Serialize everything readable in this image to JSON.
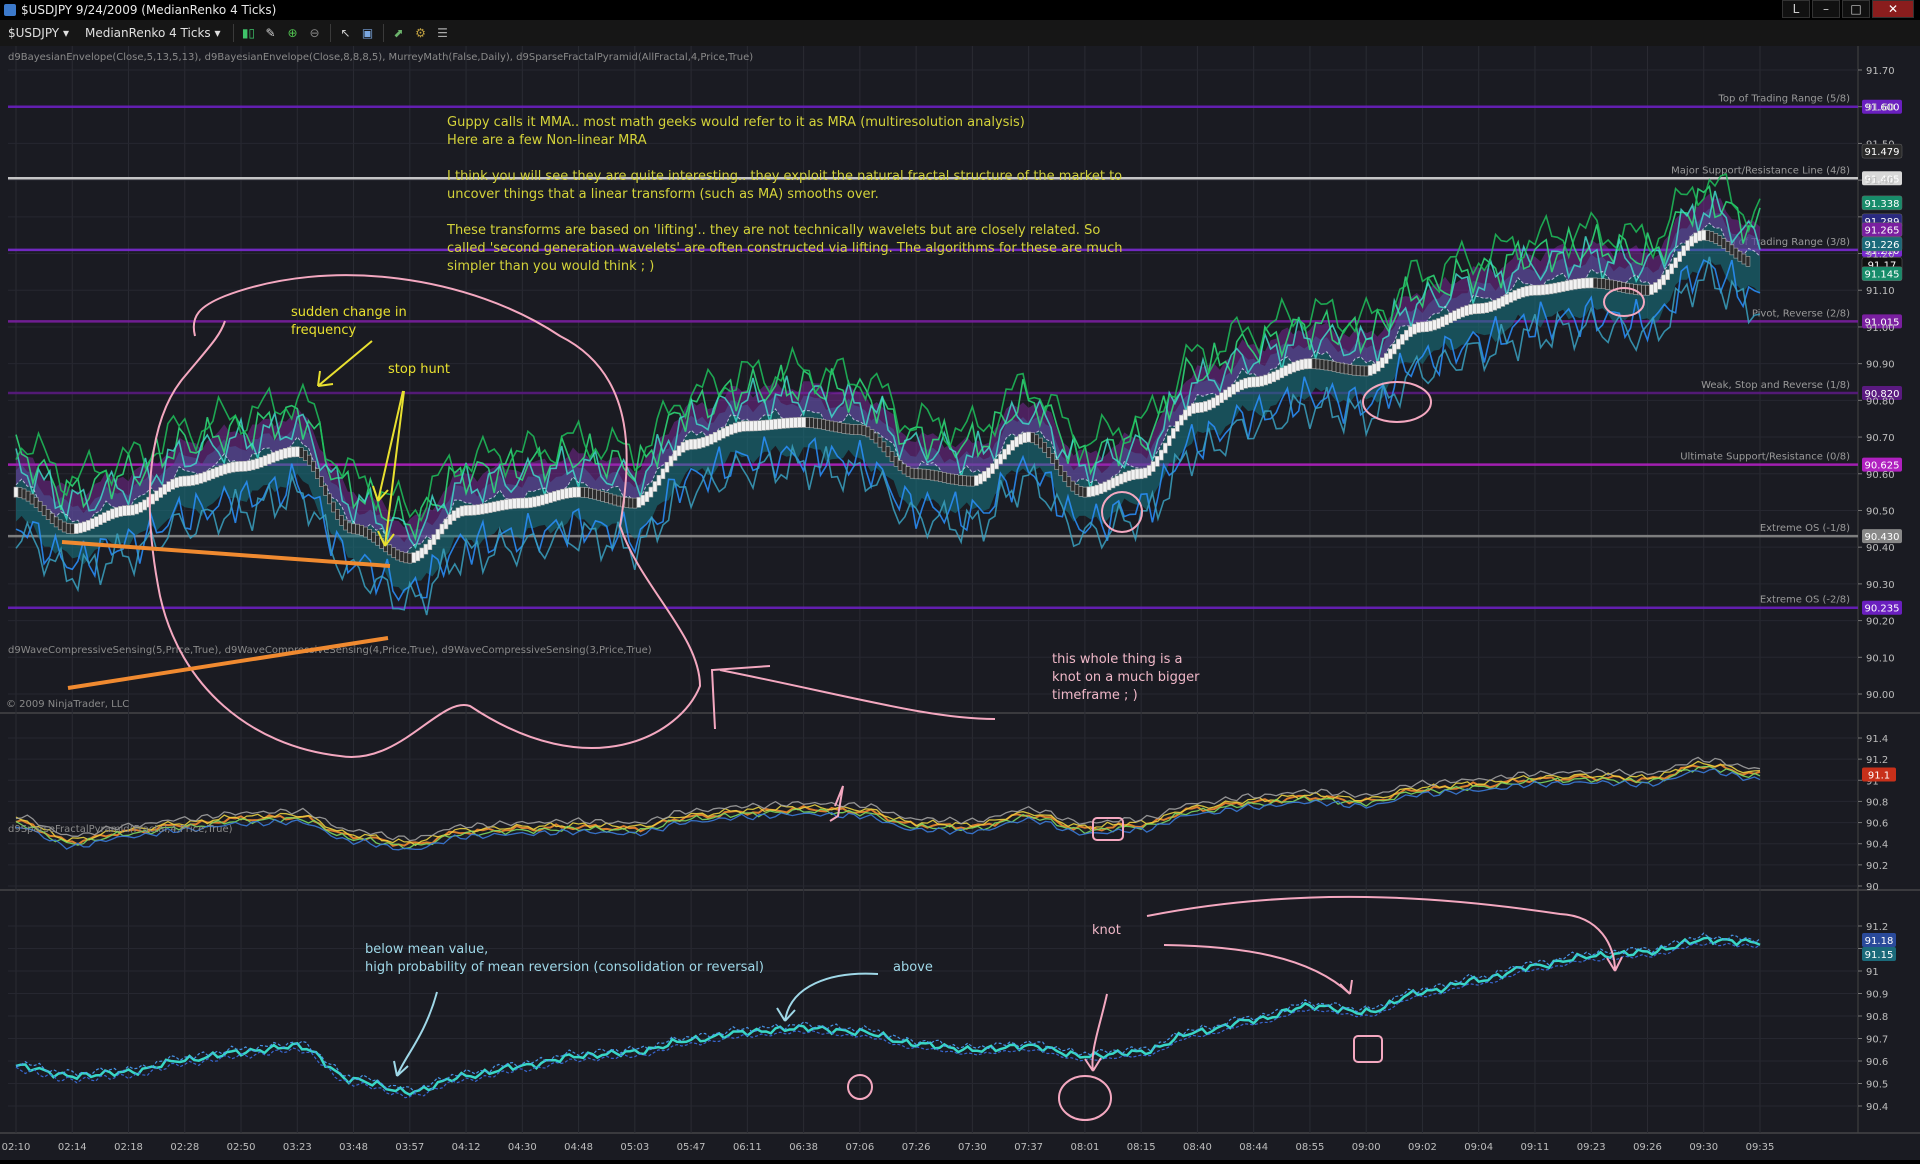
{
  "window": {
    "title": "$USDJPY  9/24/2009 (MedianRenko 4 Ticks)",
    "controls": [
      "L",
      "–",
      "□",
      "✕"
    ]
  },
  "toolbar": {
    "instrument": "$USDJPY",
    "period": "MedianRenko 4 Ticks"
  },
  "panels": [
    {
      "indicator_label": "d9BayesianEnvelope(Close,5,13,5,13), d9BayesianEnvelope(Close,8,8,8,5), MurreyMath(False,Daily), d9SparseFractalPyramid(AllFractal,4,Price,True)",
      "y_ticks": [
        "91.70",
        "91.60",
        "91.50",
        "91.40",
        "91.30",
        "91.20",
        "91.10",
        "91.00",
        "90.90",
        "90.80",
        "90.70",
        "90.60",
        "90.50",
        "90.40",
        "90.30",
        "90.20",
        "90.10",
        "90.00"
      ]
    },
    {
      "indicator_label": "d9WaveCompressiveSensing(5,Price,True), d9WaveCompressiveSensing(4,Price,True), d9WaveCompressiveSensing(3,Price,True)",
      "y_ticks": [
        "91.4",
        "91.2",
        "91",
        "90.8",
        "90.6",
        "90.4",
        "90.2",
        "90"
      ]
    },
    {
      "indicator_label": "d9SparseFractalPyramid(Fractal,4,Price,True)",
      "y_ticks": [
        "91.2",
        "91.1",
        "91",
        "90.9",
        "90.8",
        "90.7",
        "90.6",
        "90.5",
        "90.4"
      ]
    }
  ],
  "x_ticks": [
    "02:10",
    "02:14",
    "02:18",
    "02:28",
    "02:50",
    "03:23",
    "03:48",
    "03:57",
    "04:12",
    "04:30",
    "04:48",
    "05:03",
    "05:47",
    "06:11",
    "06:38",
    "07:06",
    "07:26",
    "07:30",
    "07:37",
    "08:01",
    "08:15",
    "08:40",
    "08:44",
    "08:55",
    "09:00",
    "09:02",
    "09:04",
    "09:11",
    "09:23",
    "09:26",
    "09:30",
    "09:35"
  ],
  "murrey_lines": [
    {
      "label": "Top of Trading Range (5/8)",
      "value": "91.600",
      "color": "#6a1fbf"
    },
    {
      "label": "Major Support/Resistance Line (4/8)",
      "value": "91.405",
      "color": "#d8d8d8"
    },
    {
      "label": "Top of Trading Range (3/8)",
      "value": "91.210",
      "color": "#7a2ad0"
    },
    {
      "label": "Pivot, Reverse (2/8)",
      "value": "91.015",
      "color": "#7a1fa0"
    },
    {
      "label": "Weak, Stop and Reverse (1/8)",
      "value": "90.820",
      "color": "#5a1a80"
    },
    {
      "label": "Ultimate Support/Resistance (0/8)",
      "value": "90.625",
      "color": "#b020c0"
    },
    {
      "label": "Extreme OS (-1/8)",
      "value": "90.430",
      "color": "#888888"
    },
    {
      "label": "Extreme OS (-2/8)",
      "value": "90.235",
      "color": "#6a1fbf"
    }
  ],
  "price_badges": [
    {
      "value": "91.479",
      "color": "#2a2a2a"
    },
    {
      "value": "91.338",
      "color": "#178c6a"
    },
    {
      "value": "91.289",
      "color": "#2a2a80"
    },
    {
      "value": "91.265",
      "color": "#7a1fa0"
    },
    {
      "value": "91.226",
      "color": "#1b6a7a"
    },
    {
      "value": "91.17",
      "color": "#101010"
    },
    {
      "value": "91.145",
      "color": "#178c6a"
    }
  ],
  "lower_badges": [
    {
      "value": "91.1",
      "color": "#c8301a"
    },
    {
      "value": "91.18",
      "color": "#2a4a9a"
    },
    {
      "value": "91.15",
      "color": "#1b6a7a"
    }
  ],
  "copyright": "© 2009 NinjaTrader, LLC",
  "annotations": {
    "main_text": [
      "Guppy calls it MMA.. most math geeks would refer to it as MRA (multiresolution analysis)",
      "Here are a few Non-linear MRA",
      "",
      "I think you will see they are quite interesting.. they exploit the natural fractal structure of the market to",
      "uncover things that a linear transform (such as MA) smooths over.",
      "",
      "These transforms are based on 'lifting'.. they are not technically wavelets but are closely related.  So",
      "called 'second generation wavelets' are often constructed via lifting.  The algorithms for these are much",
      "simpler than you would think ; )"
    ],
    "sudden_change": [
      "sudden change in",
      "frequency"
    ],
    "stop_hunt": "stop hunt",
    "knot_text": [
      "this whole thing is a",
      "knot on a much bigger",
      "timeframe ; )"
    ],
    "below_mean": [
      "below mean value,",
      "high probability of mean reversion (consolidation or reversal)"
    ],
    "above": "above",
    "knot": "knot"
  },
  "chart_data": [
    {
      "type": "line",
      "title": "",
      "ylim": [
        90.0,
        91.7
      ],
      "x": [
        "02:10",
        "02:14",
        "02:18",
        "02:28",
        "02:50",
        "03:23",
        "03:48",
        "03:57",
        "04:12",
        "04:30",
        "04:48",
        "05:03",
        "05:47",
        "06:11",
        "06:38",
        "07:06",
        "07:26",
        "07:30",
        "07:37",
        "08:01",
        "08:15",
        "08:40",
        "08:44",
        "08:55",
        "09:00",
        "09:02",
        "09:04",
        "09:11",
        "09:23",
        "09:26",
        "09:30",
        "09:35"
      ],
      "series": [
        {
          "values": [
            90.55,
            90.45,
            90.5,
            90.58,
            90.62,
            90.66,
            90.45,
            90.37,
            90.5,
            90.52,
            90.55,
            90.52,
            90.68,
            90.73,
            90.74,
            90.72,
            90.6,
            90.58,
            90.7,
            90.55,
            90.6,
            90.78,
            90.85,
            90.9,
            90.88,
            91.0,
            91.05,
            91.1,
            91.12,
            91.1,
            91.25,
            91.17
          ]
        }
      ]
    },
    {
      "type": "line",
      "title": "",
      "ylim": [
        90.0,
        91.5
      ],
      "x": [
        "02:10",
        "02:14",
        "02:18",
        "02:28",
        "02:50",
        "03:23",
        "03:48",
        "03:57",
        "04:12",
        "04:30",
        "04:48",
        "05:03",
        "05:47",
        "06:11",
        "06:38",
        "07:06",
        "07:26",
        "07:30",
        "07:37",
        "08:01",
        "08:15",
        "08:40",
        "08:44",
        "08:55",
        "09:00",
        "09:02",
        "09:04",
        "09:11",
        "09:23",
        "09:26",
        "09:30",
        "09:35"
      ],
      "series": [
        {
          "values": [
            90.65,
            90.45,
            90.55,
            90.62,
            90.68,
            90.7,
            90.5,
            90.42,
            90.55,
            90.58,
            90.6,
            90.58,
            90.7,
            90.75,
            90.78,
            90.76,
            90.62,
            90.6,
            90.72,
            90.58,
            90.62,
            90.78,
            90.85,
            90.9,
            90.86,
            90.98,
            91.02,
            91.08,
            91.1,
            91.08,
            91.22,
            91.13
          ]
        }
      ]
    },
    {
      "type": "line",
      "title": "",
      "ylim": [
        90.35,
        91.25
      ],
      "x": [
        "02:10",
        "02:14",
        "02:18",
        "02:28",
        "02:50",
        "03:23",
        "03:48",
        "03:57",
        "04:12",
        "04:30",
        "04:48",
        "05:03",
        "05:47",
        "06:11",
        "06:38",
        "07:06",
        "07:26",
        "07:30",
        "07:37",
        "08:01",
        "08:15",
        "08:40",
        "08:44",
        "08:55",
        "09:00",
        "09:02",
        "09:04",
        "09:11",
        "09:23",
        "09:26",
        "09:30",
        "09:35"
      ],
      "series": [
        {
          "values": [
            90.55,
            90.5,
            90.52,
            90.58,
            90.62,
            90.65,
            90.48,
            90.42,
            90.5,
            90.55,
            90.6,
            90.62,
            90.68,
            90.72,
            90.74,
            90.72,
            90.66,
            90.63,
            90.65,
            90.6,
            90.62,
            90.72,
            90.78,
            90.85,
            90.82,
            90.92,
            90.98,
            91.05,
            91.1,
            91.12,
            91.18,
            91.17
          ]
        }
      ]
    }
  ]
}
